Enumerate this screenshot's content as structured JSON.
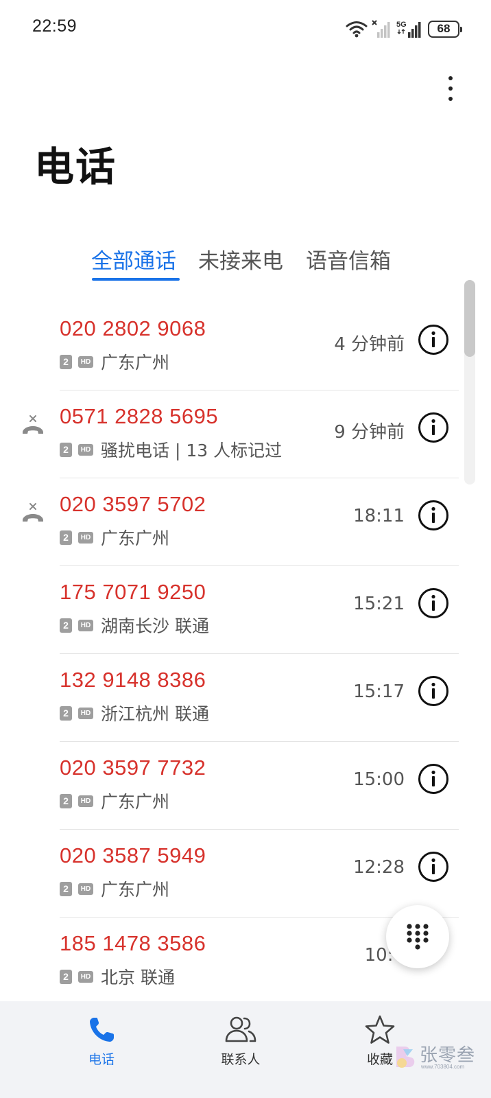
{
  "status_bar": {
    "time": "22:59",
    "network": "5G",
    "battery": "68"
  },
  "header": {
    "title": "电话"
  },
  "tabs": [
    {
      "label": "全部通话",
      "active": true
    },
    {
      "label": "未接来电",
      "active": false
    },
    {
      "label": "语音信箱",
      "active": false
    }
  ],
  "calls": [
    {
      "number": "020 2802 9068",
      "sim": "2",
      "hd": "HD",
      "location": "广东广州",
      "time": "4 分钟前",
      "missed": false
    },
    {
      "number": "0571 2828 5695",
      "sim": "2",
      "hd": "HD",
      "location": "骚扰电话 | 13 人标记过",
      "time": "9 分钟前",
      "missed": true
    },
    {
      "number": "020 3597 5702",
      "sim": "2",
      "hd": "HD",
      "location": "广东广州",
      "time": "18:11",
      "missed": true
    },
    {
      "number": "175 7071 9250",
      "sim": "2",
      "hd": "HD",
      "location": "湖南长沙 联通",
      "time": "15:21",
      "missed": false
    },
    {
      "number": "132 9148 8386",
      "sim": "2",
      "hd": "HD",
      "location": "浙江杭州 联通",
      "time": "15:17",
      "missed": false
    },
    {
      "number": "020 3597 7732",
      "sim": "2",
      "hd": "HD",
      "location": "广东广州",
      "time": "15:00",
      "missed": false
    },
    {
      "number": "020 3587 5949",
      "sim": "2",
      "hd": "HD",
      "location": "广东广州",
      "time": "12:28",
      "missed": false
    },
    {
      "number": "185 1478 3586",
      "sim": "2",
      "hd": "HD",
      "location": "北京 联通",
      "time": "10:4",
      "missed": false
    }
  ],
  "bottom_nav": [
    {
      "label": "电话",
      "icon": "phone-icon",
      "active": true
    },
    {
      "label": "联系人",
      "icon": "contacts-icon",
      "active": false
    },
    {
      "label": "收藏",
      "icon": "star-icon",
      "active": false
    }
  ],
  "watermark": {
    "text": "张零叁",
    "url": "www.703804.com"
  },
  "colors": {
    "accent": "#1a73e8",
    "missed_number": "#d7322c",
    "nav_background": "#f2f3f6"
  }
}
